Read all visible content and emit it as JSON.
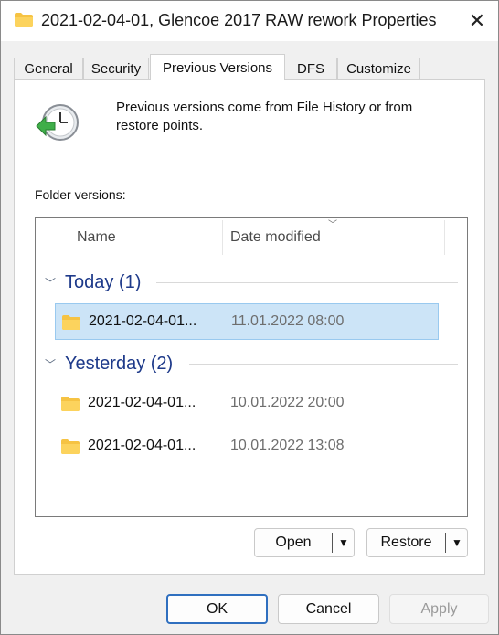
{
  "window": {
    "title": "2021-02-04-01, Glencoe 2017 RAW rework Properties",
    "close_symbol": "✕"
  },
  "tabs": [
    {
      "label": "General"
    },
    {
      "label": "Security"
    },
    {
      "label": "Previous Versions",
      "active": true
    },
    {
      "label": "DFS"
    },
    {
      "label": "Customize"
    }
  ],
  "info": {
    "text": "Previous versions come from File History or from restore points.",
    "icon": "restore-clock-icon"
  },
  "folder_versions_label": "Folder versions:",
  "list": {
    "columns": {
      "name": "Name",
      "date_modified": "Date modified"
    },
    "groups": [
      {
        "title": "Today (1)",
        "items": [
          {
            "name": "2021-02-04-01...",
            "date": "11.01.2022 08:00",
            "selected": true
          }
        ]
      },
      {
        "title": "Yesterday (2)",
        "items": [
          {
            "name": "2021-02-04-01...",
            "date": "10.01.2022 20:00"
          },
          {
            "name": "2021-02-04-01...",
            "date": "10.01.2022 13:08"
          }
        ]
      }
    ]
  },
  "actions": {
    "open": "Open",
    "restore": "Restore"
  },
  "footer": {
    "ok": "OK",
    "cancel": "Cancel",
    "apply": "Apply"
  },
  "colors": {
    "accent": "#2f6fbf",
    "selection": "#cce4f7",
    "group_title": "#1e3a8a",
    "folder": "#f6c343"
  }
}
